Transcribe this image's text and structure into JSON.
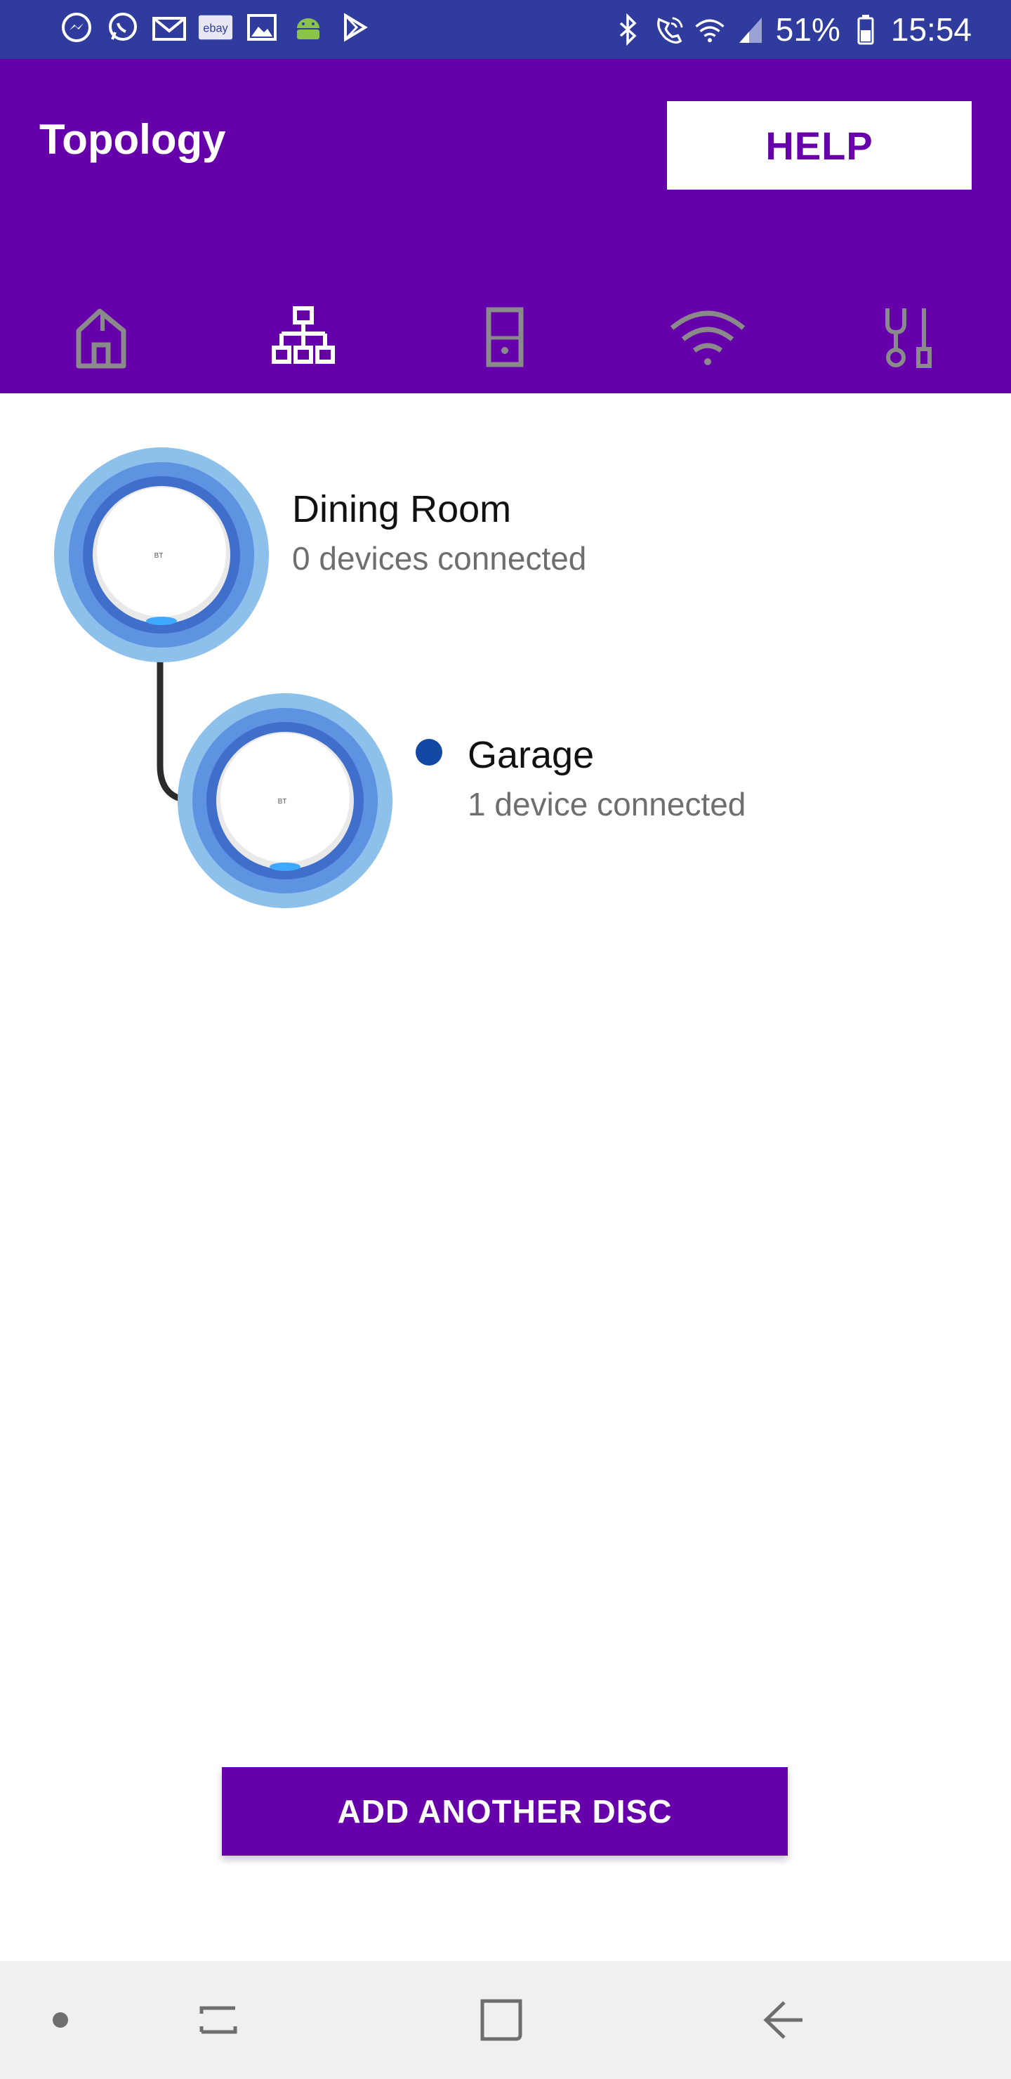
{
  "status_bar": {
    "battery": "51%",
    "time": "15:54",
    "left_icons": [
      "messenger-icon",
      "whatsapp-icon",
      "mail-icon",
      "ebay-icon",
      "gallery-icon",
      "android-icon",
      "play-store-icon"
    ],
    "right_icons": [
      "bluetooth-icon",
      "wifi-calling-icon",
      "wifi-icon",
      "signal-icon",
      "battery-icon"
    ],
    "background": "#2f3c9e"
  },
  "header": {
    "title": "Topology",
    "help_label": "HELP",
    "background": "#6600aa"
  },
  "tabs": [
    {
      "name": "home",
      "icon": "home-icon",
      "active": false
    },
    {
      "name": "topology",
      "icon": "topology-icon",
      "active": true
    },
    {
      "name": "devices",
      "icon": "device-icon",
      "active": false
    },
    {
      "name": "wifi",
      "icon": "wifi-icon",
      "active": false
    },
    {
      "name": "tools",
      "icon": "tools-icon",
      "active": false
    }
  ],
  "nodes": [
    {
      "name": "Dining Room",
      "devices": "0 devices connected",
      "status_dot": false
    },
    {
      "name": "Garage",
      "devices": "1 device connected",
      "status_dot": true
    }
  ],
  "add_button_label": "ADD ANOTHER DISC",
  "colors": {
    "accent": "#6600aa",
    "tab_inactive": "#8a8a8a",
    "disc_ring_outer": "#8ec0ec",
    "disc_ring_mid": "#5d93e0",
    "disc_ring_inner": "#3f6fcb",
    "status_dot": "#1247a4"
  },
  "nav_icons": [
    "dot-icon",
    "recent-apps-icon",
    "home-square-icon",
    "back-icon"
  ]
}
